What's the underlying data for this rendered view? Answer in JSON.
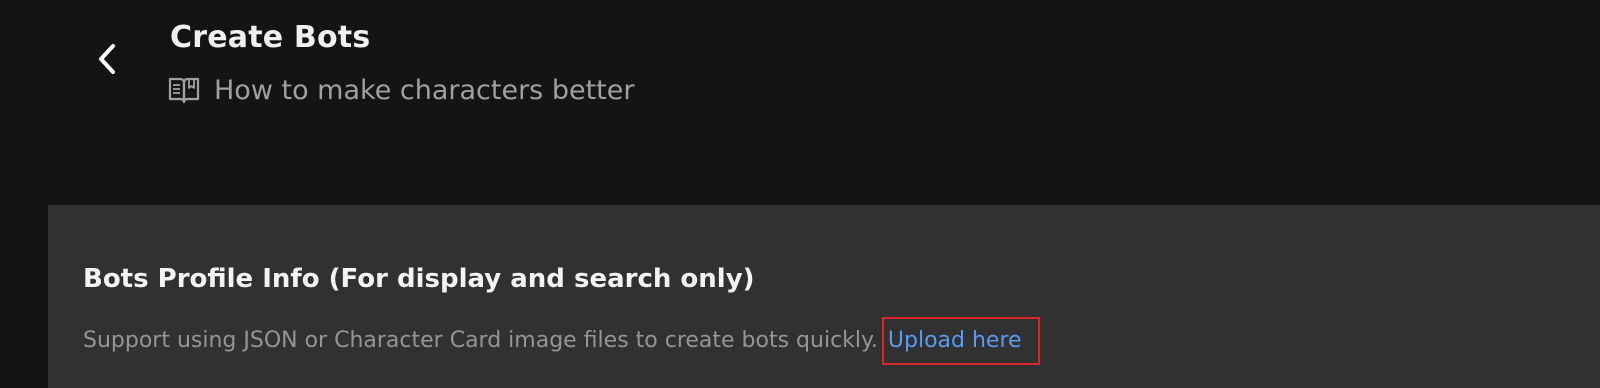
{
  "header": {
    "back_icon": "chevron-left-icon",
    "title": "Create Bots",
    "guide_icon": "book-icon",
    "guide_link": "How to make characters better"
  },
  "profile_panel": {
    "title": "Bots Profile Info (For display and search only)",
    "description": "Support using JSON or Character Card image files to create bots quickly.",
    "upload_link": "Upload here",
    "highlight_color": "#d9262a",
    "link_color": "#5a9bf0"
  }
}
